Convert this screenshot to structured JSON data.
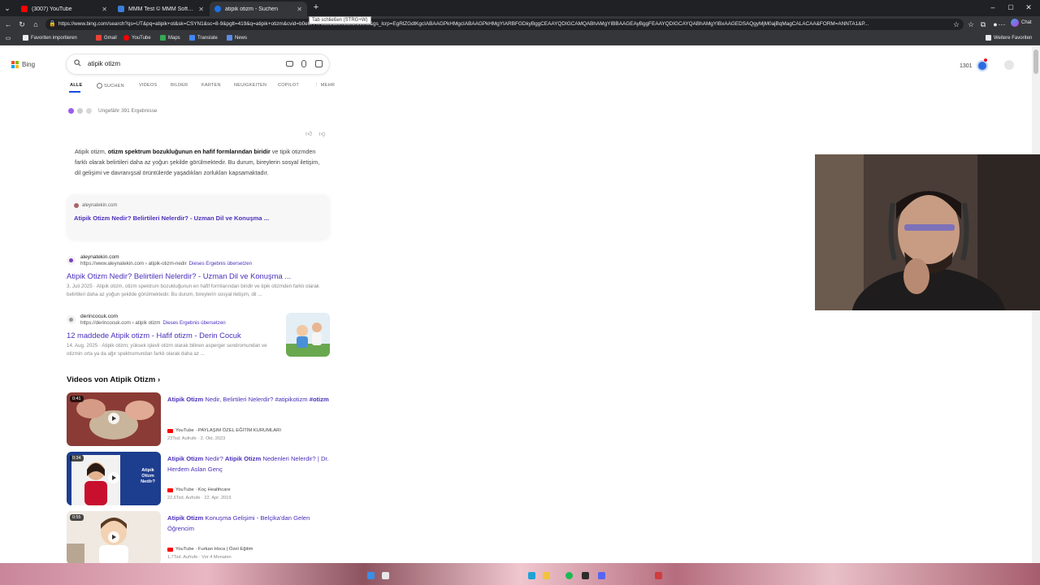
{
  "browser": {
    "tabs": [
      {
        "title": "(3007) YouTube",
        "color": "#ff0000",
        "active": false
      },
      {
        "title": "MMM Test © MMM Software 202…",
        "color": "#3c7dd9",
        "active": false
      },
      {
        "title": "atipik otizm - Suchen",
        "color": "#1a73e8",
        "active": true
      }
    ],
    "new_tab": "+",
    "tooltip": "Tab schließen (STRG+W)",
    "url": "https://www.bing.com/search?qs=UT&pq=atipik+ot&sk=CSYN1&sc=8-9&pglt=419&q=atipik+otizm&cvid=b0e0f4476d92c280ba02f599fb&gs_lcrp=EgRlZGdlKgcIABAAGPkHMgcIABAAGPkHMgYIARBFGDkyBggCEAAYQDIGCAMQABhAMgYIBBAAGEAyBggFEAAYQDIGCAYQABhAMgYIBxAAGEDSAQgyMjM0ajBqMagCALACAA&FORM=ANNTA1&P...",
    "bookmarks": [
      "Favoriten importieren",
      "Gmail",
      "YouTube",
      "Maps",
      "Translate",
      "News"
    ],
    "other_favorites": "Weitere Favoriten",
    "chat": "Chat"
  },
  "bing": {
    "logo": "Bing",
    "query": "atipik otizm",
    "nav": [
      "ALLE",
      "SUCHEN",
      "VIDEOS",
      "BILDER",
      "KARTEN",
      "NEUIGKEITEN",
      "COPILOT",
      "MEHR"
    ],
    "rewards_points": "1301",
    "result_count": "Ungefähr 391 Ergebnisse",
    "ai_answer": {
      "lead": "Atipik otizm, ",
      "bold": "otizm spektrum bozukluğunun en hafif formlarından biridir",
      "rest": " ve tipik otizmden farklı olarak belirtileri daha az yoğun şekilde görülmektedir. Bu durum, bireylerin sosyal iletişim, dil gelişimi ve davranışsal örüntülerde yaşadıkları zorlukları kapsamaktadır.",
      "source": "aleynatekin.com",
      "link": "Atipik Otizm Nedir? Belirtileri Nelerdir? - Uzman Dil ve Konuşma ..."
    },
    "results": [
      {
        "site": "aleynatekin.com",
        "url": "https://www.aleynatekin.com › atipik-otizm-nedir",
        "translate": "Dieses Ergebnis übersetzen",
        "title": "Atipik Otizm Nedir? Belirtileri Nelerdir? - Uzman Dil ve Konuşma ...",
        "snippet": "3. Juli 2025 · Atipik otizm, otizm spektrum bozukluğunun en hafif formlarından biridir ve tipik otizmden farklı olarak belirtileri daha az yoğun şekilde görülmektedir. Bu durum, bireylerin sosyal iletişim, dil ..."
      },
      {
        "site": "derincocuk.com",
        "url": "https://derincocuk.com › atipik otizm",
        "translate": "Dieses Ergebnis übersetzen",
        "title": "12 maddede Atipik otizm - Hafif otizm - Derin Cocuk",
        "snippet": "14. Aug. 2025 · Atipik otizm; yüksek işlevli otizm olarak bilinen asperger sendromundan ve otizmin orta ya da ağır spektrumundan farklı olarak daha az ..."
      }
    ],
    "videos_heading": "Videos von Atipik Otizm",
    "videos": [
      {
        "duration": "0:41",
        "t1": "Atipik Otizm",
        "t2": " Nedir, Belirtileri Nelerdir? #atipikotizm ",
        "t3": "#otizm",
        "channel": "YouTube · PAYLAŞIM ÖZEL EĞİTİM KURUMLARI",
        "stats": "23Tsd. Aufrufe · 2. Okt. 2023"
      },
      {
        "duration": "0:34",
        "t1": "Atipik Otizm",
        "t2": " Nedir? ",
        "t3": "Atipik Otizm",
        "t4": " Nedenleri Nelerdir? | Dr. Herdem Aslan Genç",
        "channel": "YouTube · Koç Healthcare",
        "stats": "22,6Tsd. Aufrufe · 22. Apr. 2019",
        "overlay": "Atipik Otizm Nedir?"
      },
      {
        "duration": "0:55",
        "t1": "Atipik Otizm",
        "t2": " Konuşma Gelişimi - Belçika'dan Gelen Öğrencim",
        "channel": "YouTube · Furkan Hoca | Özel Eğitim",
        "stats": "1,7Tsd. Aufrufe · Vor 4 Monaten"
      }
    ]
  }
}
